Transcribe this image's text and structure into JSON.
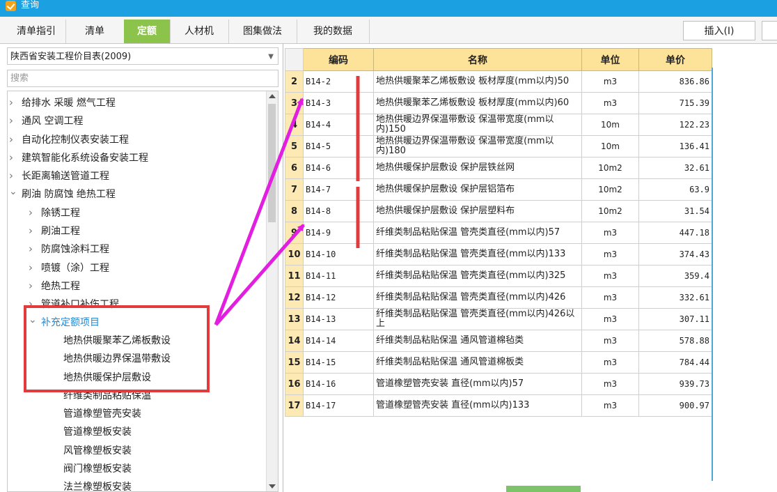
{
  "window": {
    "title": "查询"
  },
  "tabs": [
    {
      "label": "清单指引",
      "active": false
    },
    {
      "label": "清单",
      "active": false
    },
    {
      "label": "定额",
      "active": true
    },
    {
      "label": "人材机",
      "active": false
    },
    {
      "label": "图集做法",
      "active": false
    },
    {
      "label": "我的数据",
      "active": false
    }
  ],
  "toolbar": {
    "insert_label": "插入(I)"
  },
  "left": {
    "catalog": "陕西省安装工程价目表(2009)",
    "search_placeholder": "搜索",
    "tree": [
      {
        "label": "给排水 采暖 燃气工程",
        "arrow": ">"
      },
      {
        "label": "通风 空调工程",
        "arrow": ">"
      },
      {
        "label": "自动化控制仪表安装工程",
        "arrow": ">"
      },
      {
        "label": "建筑智能化系统设备安装工程",
        "arrow": ">"
      },
      {
        "label": "长距离输送管道工程",
        "arrow": ">"
      },
      {
        "label": "刷油 防腐蚀 绝热工程",
        "arrow": "v"
      },
      {
        "label": "除锈工程",
        "arrow": ">"
      },
      {
        "label": "刷油工程",
        "arrow": ">"
      },
      {
        "label": "防腐蚀涂料工程",
        "arrow": ">"
      },
      {
        "label": "喷镀（涂）工程",
        "arrow": ">"
      },
      {
        "label": "绝热工程",
        "arrow": ">"
      },
      {
        "label": "管道补口补伤工程",
        "arrow": ">"
      },
      {
        "label": "补充定额项目",
        "arrow": "v"
      },
      {
        "label": "地热供暖聚苯乙烯板敷设",
        "arrow": ""
      },
      {
        "label": "地热供暖边界保温带敷设",
        "arrow": ""
      },
      {
        "label": "地热供暖保护层敷设",
        "arrow": ""
      },
      {
        "label": "纤维类制品粘贴保温",
        "arrow": ""
      },
      {
        "label": "管道橡塑管壳安装",
        "arrow": ""
      },
      {
        "label": "管道橡塑板安装",
        "arrow": ""
      },
      {
        "label": "风管橡塑板安装",
        "arrow": ""
      },
      {
        "label": "阀门橡塑板安装",
        "arrow": ""
      },
      {
        "label": "法兰橡塑板安装",
        "arrow": ""
      }
    ]
  },
  "grid": {
    "headers": {
      "code": "编码",
      "name": "名称",
      "unit": "单位",
      "price": "单价"
    },
    "rows": [
      {
        "num": "2",
        "code": "B14-2",
        "name": "地热供暖聚苯乙烯板敷设 板材厚度(mm以内)50",
        "unit": "m3",
        "price": "836.86"
      },
      {
        "num": "3",
        "code": "B14-3",
        "name": "地热供暖聚苯乙烯板敷设 板材厚度(mm以内)60",
        "unit": "m3",
        "price": "715.39"
      },
      {
        "num": "4",
        "code": "B14-4",
        "name": "地热供暖边界保温带敷设 保温带宽度(mm以内)150",
        "unit": "10m",
        "price": "122.23"
      },
      {
        "num": "5",
        "code": "B14-5",
        "name": "地热供暖边界保温带敷设 保温带宽度(mm以内)180",
        "unit": "10m",
        "price": "136.41"
      },
      {
        "num": "6",
        "code": "B14-6",
        "name": "地热供暖保护层敷设 保护层铁丝网",
        "unit": "10m2",
        "price": "32.61"
      },
      {
        "num": "7",
        "code": "B14-7",
        "name": "地热供暖保护层敷设 保护层铝箔布",
        "unit": "10m2",
        "price": "63.9"
      },
      {
        "num": "8",
        "code": "B14-8",
        "name": "地热供暖保护层敷设 保护层塑料布",
        "unit": "10m2",
        "price": "31.54"
      },
      {
        "num": "9",
        "code": "B14-9",
        "name": "纤维类制品粘贴保温 管壳类直径(mm以内)57",
        "unit": "m3",
        "price": "447.18"
      },
      {
        "num": "10",
        "code": "B14-10",
        "name": "纤维类制品粘贴保温 管壳类直径(mm以内)133",
        "unit": "m3",
        "price": "374.43"
      },
      {
        "num": "11",
        "code": "B14-11",
        "name": "纤维类制品粘贴保温 管壳类直径(mm以内)325",
        "unit": "m3",
        "price": "359.4"
      },
      {
        "num": "12",
        "code": "B14-12",
        "name": "纤维类制品粘贴保温 管壳类直径(mm以内)426",
        "unit": "m3",
        "price": "332.61"
      },
      {
        "num": "13",
        "code": "B14-13",
        "name": "纤维类制品粘贴保温 管壳类直径(mm以内)426以上",
        "unit": "m3",
        "price": "307.11"
      },
      {
        "num": "14",
        "code": "B14-14",
        "name": "纤维类制品粘贴保温 通风管道棉毡类",
        "unit": "m3",
        "price": "578.88"
      },
      {
        "num": "15",
        "code": "B14-15",
        "name": "纤维类制品粘贴保温 通风管道棉板类",
        "unit": "m3",
        "price": "784.44"
      },
      {
        "num": "16",
        "code": "B14-16",
        "name": "管道橡塑管壳安装 直径(mm以内)57",
        "unit": "m3",
        "price": "939.73"
      },
      {
        "num": "17",
        "code": "B14-17",
        "name": "管道橡塑管壳安装 直径(mm以内)133",
        "unit": "m3",
        "price": "900.97"
      }
    ]
  },
  "colors": {
    "titlebar": "#1ba0e2",
    "active_tab": "#8cc34a",
    "header_bg": "#fde39a",
    "annotation_red": "#e23b3b",
    "annotation_arrow": "#e21fe0"
  }
}
